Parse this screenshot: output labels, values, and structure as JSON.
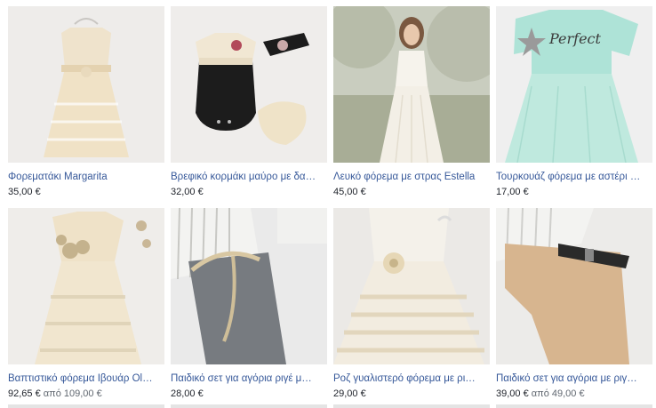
{
  "products": [
    {
      "title": "Φορεματάκι Margarita",
      "price": "35,00 €",
      "old_price": ""
    },
    {
      "title": "Βρεφικό κορμάκι μαύρο με δα…",
      "price": "32,00 €",
      "old_price": ""
    },
    {
      "title": "Λευκό φόρεμα με στρας Estella",
      "price": "45,00 €",
      "old_price": ""
    },
    {
      "title": "Τουρκουάζ φόρεμα με αστέρι …",
      "price": "17,00 €",
      "old_price": ""
    },
    {
      "title": "Βαπτιστικό φόρεμα Ιβουάρ Ol…",
      "price": "92,65 €",
      "old_price": "από 109,00 €"
    },
    {
      "title": "Παιδικό σετ για αγόρια ριγέ μ…",
      "price": "28,00 €",
      "old_price": ""
    },
    {
      "title": "Ροζ γυαλιστερό φόρεμα με ρι…",
      "price": "29,00 €",
      "old_price": ""
    },
    {
      "title": "Παιδικό σετ για αγόρια με ριγ…",
      "price": "39,00 €",
      "old_price": "από 49,00 €"
    }
  ],
  "shirt_print": "Perfect"
}
